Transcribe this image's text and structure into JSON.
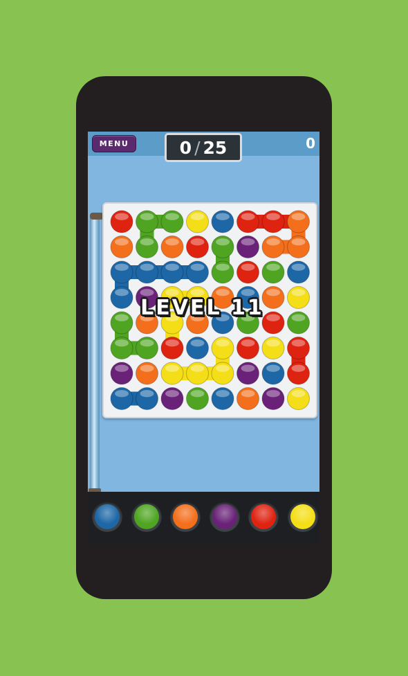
{
  "header": {
    "menu_label": "MENU",
    "moves_used": "0",
    "moves_separator": "/",
    "moves_total": "25",
    "score": "0"
  },
  "overlay": {
    "level_text": "LEVEL 11"
  },
  "colors": {
    "background": "#88c250",
    "phone": "#231f20",
    "screen": "#80b6e0",
    "B": "#1d67a6",
    "G": "#4fa522",
    "O": "#f36f1c",
    "P": "#6a2278",
    "R": "#df2311",
    "Y": "#f4de17"
  },
  "board": {
    "rows": 8,
    "cols": 8,
    "grid": [
      [
        "R",
        "G",
        "G",
        "Y",
        "B",
        "R",
        "R",
        "O"
      ],
      [
        "O",
        "G",
        "O",
        "R",
        "G",
        "P",
        "O",
        "O"
      ],
      [
        "B",
        "B",
        "B",
        "B",
        "G",
        "R",
        "G",
        "B"
      ],
      [
        "B",
        "P",
        "Y",
        "Y",
        "O",
        "B",
        "O",
        "Y"
      ],
      [
        "G",
        "O",
        "Y",
        "O",
        "B",
        "G",
        "R",
        "G"
      ],
      [
        "G",
        "G",
        "R",
        "B",
        "Y",
        "R",
        "Y",
        "R"
      ],
      [
        "P",
        "O",
        "Y",
        "Y",
        "Y",
        "P",
        "B",
        "R"
      ],
      [
        "B",
        "B",
        "P",
        "G",
        "B",
        "O",
        "P",
        "Y"
      ]
    ],
    "links": [
      [
        0,
        1,
        0,
        2
      ],
      [
        0,
        1,
        1,
        1
      ],
      [
        0,
        5,
        0,
        6
      ],
      [
        0,
        6,
        0,
        7
      ],
      [
        0,
        7,
        1,
        7
      ],
      [
        1,
        6,
        1,
        7
      ],
      [
        1,
        4,
        2,
        4
      ],
      [
        2,
        0,
        2,
        1
      ],
      [
        2,
        1,
        2,
        2
      ],
      [
        2,
        2,
        2,
        3
      ],
      [
        2,
        0,
        3,
        0
      ],
      [
        3,
        2,
        3,
        3
      ],
      [
        4,
        0,
        5,
        0
      ],
      [
        5,
        0,
        5,
        1
      ],
      [
        4,
        2,
        5,
        2
      ],
      [
        5,
        4,
        6,
        4
      ],
      [
        6,
        2,
        6,
        3
      ],
      [
        6,
        3,
        6,
        4
      ],
      [
        5,
        7,
        6,
        7
      ],
      [
        7,
        0,
        7,
        1
      ]
    ]
  },
  "palette": [
    {
      "name": "blue",
      "color": "#1d67a6"
    },
    {
      "name": "green",
      "color": "#4fa522"
    },
    {
      "name": "orange",
      "color": "#f36f1c"
    },
    {
      "name": "purple",
      "color": "#6a2278"
    },
    {
      "name": "red",
      "color": "#df2311"
    },
    {
      "name": "yellow",
      "color": "#f4de17"
    }
  ]
}
